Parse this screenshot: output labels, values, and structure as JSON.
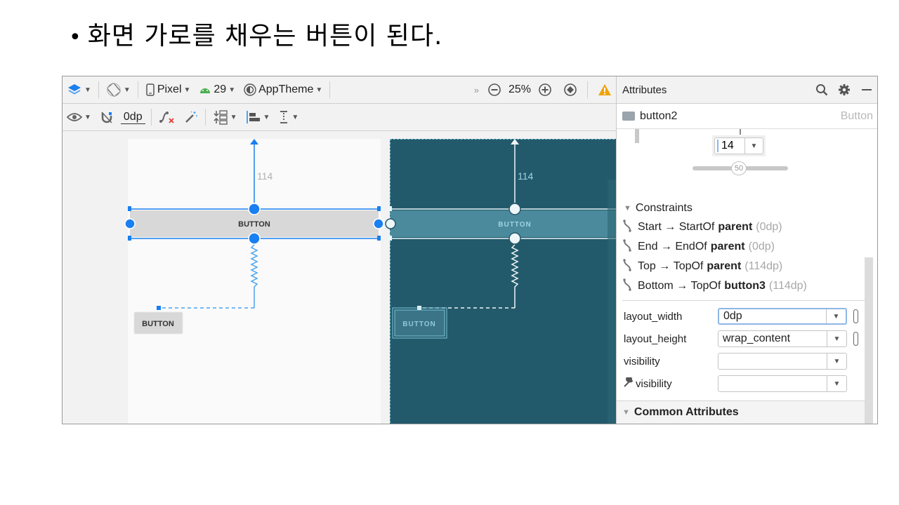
{
  "slide": {
    "bullet": "•",
    "title": "화면 가로를 채우는 버튼이 된다."
  },
  "toolbar_top": {
    "device": "Pixel",
    "api_level": "29",
    "theme": "AppTheme",
    "overflow": "»",
    "zoom": "25%"
  },
  "toolbar_bottom": {
    "default_margin": "0dp"
  },
  "canvas": {
    "design": {
      "margin_label": "114",
      "button_wide_label": "BUTTON",
      "button_small_label": "BUTTON"
    },
    "blueprint": {
      "margin_label": "114",
      "button_wide_label": "BUTTON",
      "button_small_label": "BUTTON"
    }
  },
  "attributes": {
    "header_title": "Attributes",
    "component": {
      "id": "button2",
      "type": "Button"
    },
    "widget": {
      "margin_value": "14",
      "bias_value": "50"
    },
    "constraints_title": "Constraints",
    "constraints": [
      {
        "side": "Start",
        "target_anchor": "StartOf",
        "target": "parent",
        "margin": "(0dp)"
      },
      {
        "side": "End",
        "target_anchor": "EndOf",
        "target": "parent",
        "margin": "(0dp)"
      },
      {
        "side": "Top",
        "target_anchor": "TopOf",
        "target": "parent",
        "margin": "(114dp)"
      },
      {
        "side": "Bottom",
        "target_anchor": "TopOf",
        "target": "button3",
        "margin": "(114dp)"
      }
    ],
    "fields": [
      {
        "label": "layout_width",
        "value": "0dp"
      },
      {
        "label": "layout_height",
        "value": "wrap_content"
      },
      {
        "label": "visibility",
        "value": ""
      },
      {
        "label": "visibility",
        "value": ""
      }
    ],
    "common_title": "Common Attributes"
  },
  "colors": {
    "accent_blue": "#1a7ff0",
    "blueprint_bg": "#235a6b",
    "warning": "#f0a30a"
  }
}
